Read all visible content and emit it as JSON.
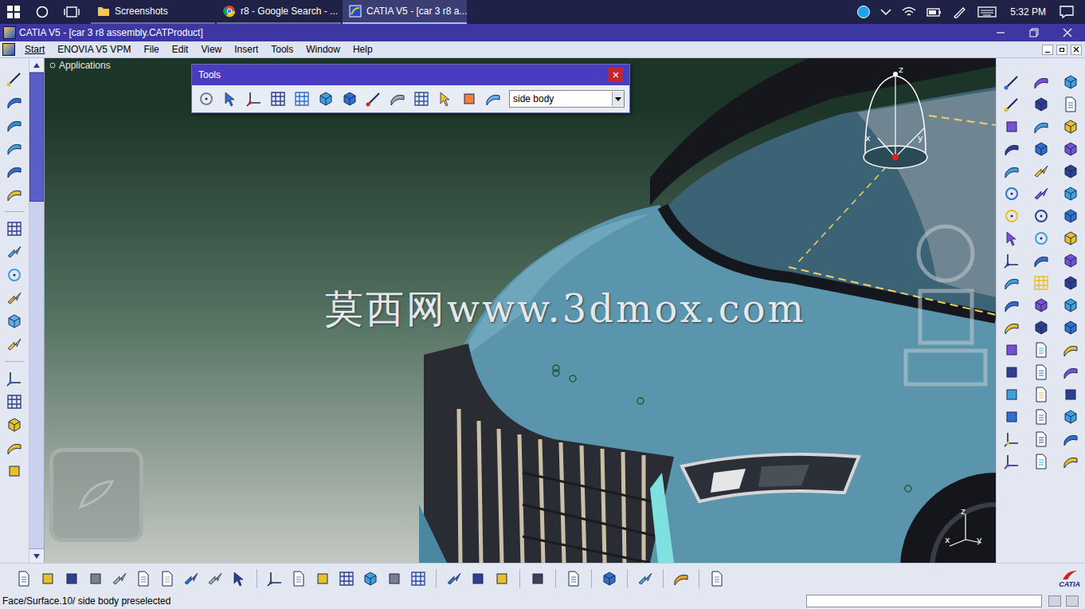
{
  "taskbar": {
    "tabs": [
      {
        "label": "Screenshots",
        "selected": false
      },
      {
        "label": "r8 - Google Search - ...",
        "selected": false
      },
      {
        "label": "CATIA V5 - [car 3 r8 a...",
        "selected": true
      }
    ],
    "clock": "5:32 PM"
  },
  "window": {
    "title": "CATIA V5 - [car 3 r8 assembly.CATProduct]"
  },
  "menu": [
    "Start",
    "ENOVIA V5 VPM",
    "File",
    "Edit",
    "View",
    "Insert",
    "Tools",
    "Window",
    "Help"
  ],
  "tools_toolbar": {
    "title": "Tools",
    "dropdown": "side body"
  },
  "viewport": {
    "tree_root": "Applications",
    "watermark": "莫西网www.3dmox.com",
    "compass_axes": [
      "x",
      "y",
      "z"
    ],
    "axis_triad": [
      "z",
      "x",
      "y"
    ]
  },
  "logo": "CATIA",
  "status_bar": {
    "message": "Face/Surface.10/ side body preselected"
  }
}
